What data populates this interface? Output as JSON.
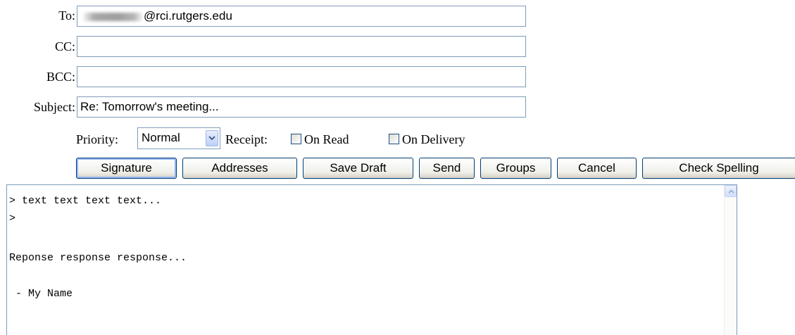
{
  "fields": {
    "to": {
      "label": "To:",
      "value": "@rci.rutgers.edu"
    },
    "cc": {
      "label": "CC:",
      "value": ""
    },
    "bcc": {
      "label": "BCC:",
      "value": ""
    },
    "subject": {
      "label": "Subject:",
      "value": "Re: Tomorrow's meeting..."
    }
  },
  "options": {
    "priority_label": "Priority:",
    "priority_value": "Normal",
    "receipt_label": "Receipt:",
    "on_read_label": "On Read",
    "on_read_checked": false,
    "on_delivery_label": "On Delivery",
    "on_delivery_checked": false
  },
  "buttons": {
    "signature": "Signature",
    "addresses": "Addresses",
    "save_draft": "Save Draft",
    "send": "Send",
    "groups": "Groups",
    "cancel": "Cancel",
    "check_spelling": "Check Spelling"
  },
  "body": {
    "lines": [
      "> text text text text...",
      ">",
      "",
      "Reponse response response...",
      "",
      " - My Name"
    ]
  },
  "icons": {
    "select_arrow": "chevron-down-icon",
    "scroll_up": "chevron-up-icon"
  }
}
